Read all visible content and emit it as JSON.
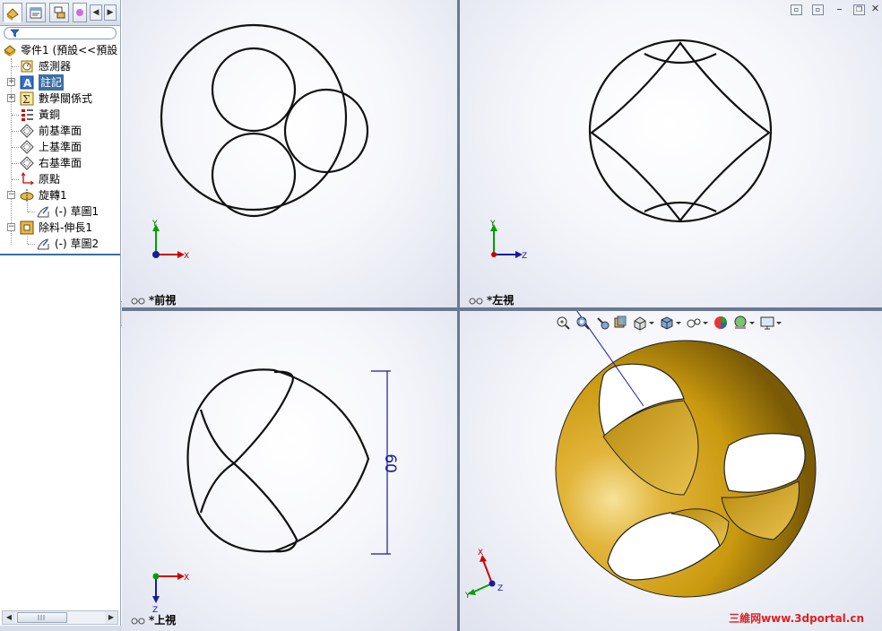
{
  "feature_tree": {
    "root_label": "零件1  (預設<<預設",
    "items": [
      {
        "label": "感測器",
        "icon": "sensor-icon"
      },
      {
        "label": "註記",
        "icon": "annotation-icon"
      },
      {
        "label": "數學關係式",
        "icon": "equation-icon"
      },
      {
        "label": "黃銅",
        "icon": "material-icon"
      },
      {
        "label": "前基準面",
        "icon": "plane-icon"
      },
      {
        "label": "上基準面",
        "icon": "plane-icon"
      },
      {
        "label": "右基準面",
        "icon": "plane-icon"
      },
      {
        "label": "原點",
        "icon": "origin-icon"
      },
      {
        "label": "旋轉1",
        "icon": "revolve-icon"
      },
      {
        "label": "(-) 草圖1",
        "icon": "sketch-icon"
      },
      {
        "label": "除料-伸長1",
        "icon": "extrude-cut-icon"
      },
      {
        "label": "(-) 草圖2",
        "icon": "sketch-icon"
      }
    ]
  },
  "viewports": {
    "front": {
      "title": "*前視",
      "axis_labels": {
        "x": "X",
        "y": "Y"
      }
    },
    "left": {
      "title": "*左視",
      "axis_labels": {
        "h": "Z",
        "v": "Y"
      }
    },
    "top": {
      "title": "*上視",
      "axis_labels": {
        "h": "X",
        "v": "Z"
      },
      "dimension": "60"
    },
    "iso": {
      "axis_labels": {
        "x": "X",
        "y": "Y",
        "z": "Z"
      }
    }
  },
  "colors": {
    "part_gold": "#d4a017",
    "part_gold_highlight": "#f3dc8a",
    "part_gold_shadow": "#8a6a0a",
    "dimension_blue": "#1a1aa0",
    "axis_red": "#d00000",
    "axis_green": "#00a000",
    "axis_blue": "#1a1aa0",
    "watermark_red": "#e02020",
    "tree_selection": "#3a6ea5"
  },
  "watermark": "三維网www.3dportal.cn"
}
